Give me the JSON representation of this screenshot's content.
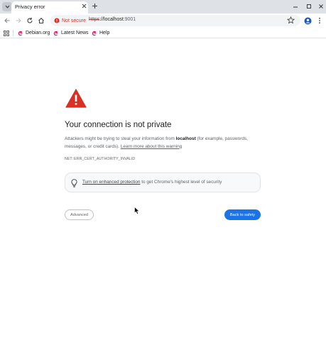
{
  "tab": {
    "title": "Privacy error"
  },
  "address_bar": {
    "security_label": "Not secure",
    "url_scheme": "https",
    "url_sep": "://",
    "url_host": "localhost",
    "url_port": ":9001"
  },
  "bookmarks": [
    {
      "label": "Debian.org"
    },
    {
      "label": "Latest News"
    },
    {
      "label": "Help"
    }
  ],
  "page": {
    "heading": "Your connection is not private",
    "para_1": "Attackers might be trying to steal your information from ",
    "para_host": "localhost",
    "para_2": " (for example, passwords, messages, or credit cards). ",
    "learn_more": "Learn more about this warning",
    "error_code": "NET::ERR_CERT_AUTHORITY_INVALID",
    "enhanced_link": "Turn on enhanced protection",
    "enhanced_rest": " to get Chrome's highest level of security",
    "advanced_button": "Advanced",
    "back_button": "Back to safety"
  },
  "colors": {
    "warning_red": "#d93025",
    "primary_blue": "#1a73e8",
    "tab_strip": "#dee1e6"
  }
}
